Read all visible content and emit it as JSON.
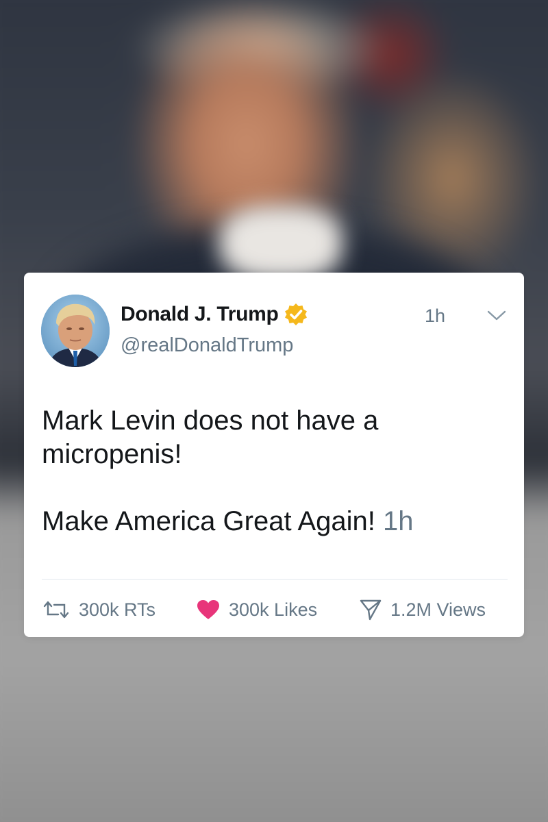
{
  "tweet": {
    "author_name": "Donald J. Trump",
    "handle": "@realDonaldTrump",
    "timestamp": "1h",
    "verified_icon": "verified-badge-icon",
    "menu_icon": "chevron-down-icon",
    "text_line_1": "Mark Levin does not have a",
    "text_line_2": "micropenis!",
    "text_line_3": "Make America Great Again!",
    "inline_timestamp": "1h"
  },
  "actions": {
    "retweets_label": "300k RTs",
    "likes_label": "300k Likes",
    "views_label": "1.2M Views",
    "retweet_icon": "retweet-icon",
    "like_icon": "heart-icon",
    "views_icon": "paper-plane-icon"
  },
  "colors": {
    "verified_badge": "#F5B81C",
    "heart": "#E8357A",
    "secondary_text": "#657786",
    "primary_text": "#14171A"
  }
}
